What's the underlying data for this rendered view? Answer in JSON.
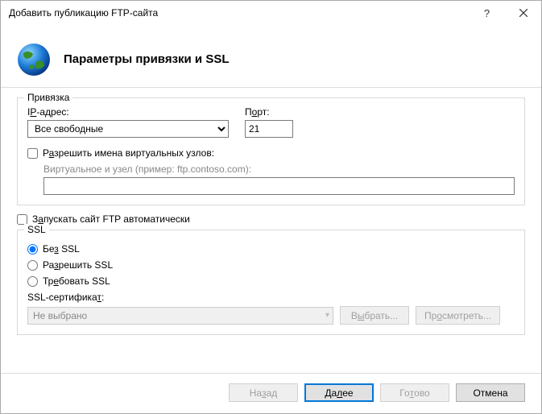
{
  "titlebar": {
    "title": "Добавить публикацию FTP-сайта"
  },
  "header": {
    "title": "Параметры привязки и SSL"
  },
  "binding": {
    "group_title": "Привязка",
    "ip_label_pre": "I",
    "ip_label_char": "P",
    "ip_label_post": "-адрес:",
    "ip_value": "Все свободные",
    "port_label_pre": "П",
    "port_label_char": "о",
    "port_label_post": "рт:",
    "port_value": "21",
    "vhost_check_pre": "Р",
    "vhost_check_char": "а",
    "vhost_check_post": "зрешить имена виртуальных узлов:",
    "vhost_label": "Виртуальное и узел (пример: ftp.contoso.com):"
  },
  "autostart": {
    "label_pre": "З",
    "label_char": "а",
    "label_post": "пускать сайт FTP автоматически"
  },
  "ssl": {
    "group_title": "SSL",
    "no_ssl_pre": "Бе",
    "no_ssl_char": "з",
    "no_ssl_post": " SSL",
    "allow_ssl_pre": "Ра",
    "allow_ssl_char": "з",
    "allow_ssl_post": "решить SSL",
    "require_ssl_pre": "Тр",
    "require_ssl_char": "е",
    "require_ssl_post": "бовать SSL",
    "cert_label_pre": "SSL-сертифика",
    "cert_label_char": "т",
    "cert_label_post": ":",
    "cert_value": "Не выбрано",
    "select_btn_pre": "В",
    "select_btn_char": "ы",
    "select_btn_post": "брать...",
    "view_btn_pre": "Пр",
    "view_btn_char": "о",
    "view_btn_post": "смотреть..."
  },
  "footer": {
    "back_pre": "На",
    "back_char": "з",
    "back_post": "ад",
    "next_pre": "Да",
    "next_char": "л",
    "next_post": "ее",
    "finish_pre": "Го",
    "finish_char": "т",
    "finish_post": "ово",
    "cancel": "Отмена"
  }
}
